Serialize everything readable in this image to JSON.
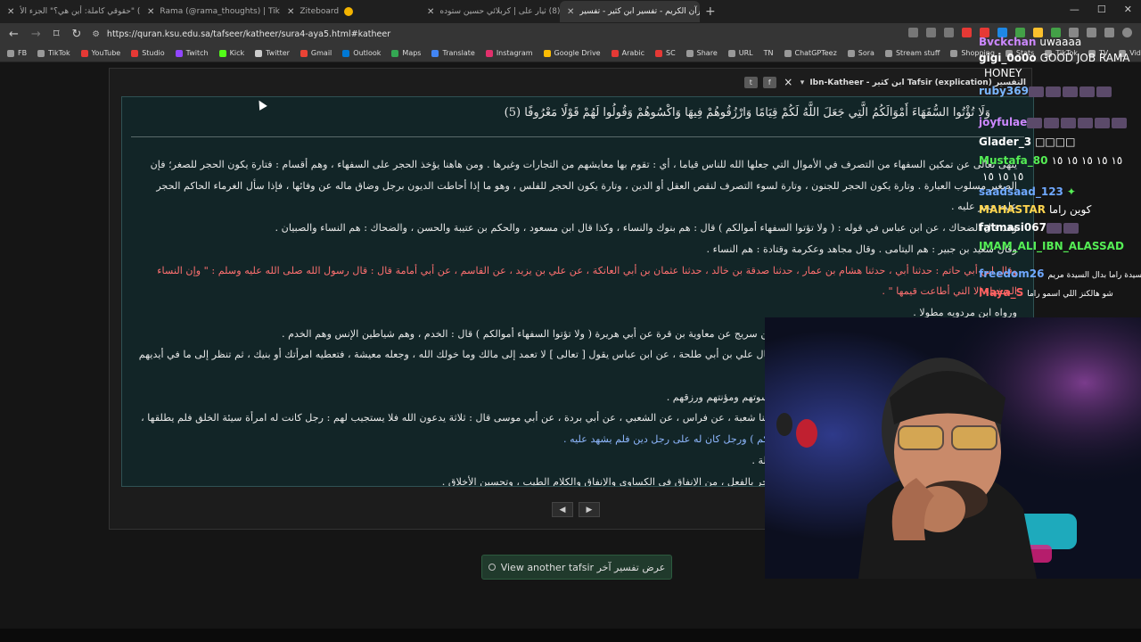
{
  "tabs": [
    {
      "label": "(8) \"حقوقي كاملة: أين هي؟\" الجزء الأ",
      "color": "#e53935"
    },
    {
      "label": "(99+) Rama (@rama_thoughts) | TikTok",
      "color": "#111111"
    },
    {
      "label": "Ziteboard",
      "color": "#f4b400"
    },
    {
      "label": "(8) ثيار على | كربلائي حسين ستوده",
      "color": "#e53935"
    },
    {
      "label": "القرآن الكريم - تفسير ابن كثير - تفسير",
      "color": "#888888",
      "active": true
    }
  ],
  "address": {
    "url": "https://quran.ksu.edu.sa/tafseer/katheer/sura4-aya5.html#katheer"
  },
  "bookmarks": [
    {
      "label": "FB",
      "color": "#999999"
    },
    {
      "label": "TikTok",
      "color": "#999999"
    },
    {
      "label": "YouTube",
      "color": "#e53935"
    },
    {
      "label": "Studio",
      "color": "#e53935"
    },
    {
      "label": "Twitch",
      "color": "#9146ff"
    },
    {
      "label": "Kick",
      "color": "#53fc18"
    },
    {
      "label": "Twitter",
      "color": "#cccccc"
    },
    {
      "label": "Gmail",
      "color": "#ea4335"
    },
    {
      "label": "Outlook",
      "color": "#0078d4"
    },
    {
      "label": "Maps",
      "color": "#34a853"
    },
    {
      "label": "Translate",
      "color": "#4285f4"
    },
    {
      "label": "Instagram",
      "color": "#e1306c"
    },
    {
      "label": "Google Drive",
      "color": "#fbbc04"
    },
    {
      "label": "Arabic",
      "color": "#e53935"
    },
    {
      "label": "SC",
      "color": "#e53935"
    },
    {
      "label": "Share",
      "color": "#999999"
    },
    {
      "label": "URL",
      "color": "#999999"
    },
    {
      "label": "TN",
      "color": "#333333"
    },
    {
      "label": "ChatGPTeez",
      "color": "#999999"
    },
    {
      "label": "Sora",
      "color": "#999999"
    },
    {
      "label": "Stream stuff",
      "color": "#999999"
    },
    {
      "label": "Shopping",
      "color": "#999999"
    },
    {
      "label": "Stats",
      "color": "#999999"
    },
    {
      "label": "TikTok",
      "color": "#999999"
    },
    {
      "label": "TV",
      "color": "#999999"
    },
    {
      "label": "Vids",
      "color": "#999999"
    }
  ],
  "panel": {
    "title": "التفسير Tafsir (explication) ابن كثير - Ibn-Katheer",
    "close": "×",
    "verse": "وَلَا تُؤْتُوا السُّفَهَاءَ أَمْوَالَكُمُ الَّتِي جَعَلَ اللَّهُ لَكُمْ قِيَامًا وَارْزُقُوهُمْ فِيهَا وَاكْسُوهُمْ وَقُولُوا لَهُمْ قَوْلًا مَعْرُوفًا (5)",
    "lines": [
      "ينهى تعالى عن تمكين السفهاء من التصرف في الأموال التي جعلها الله للناس قياما ، أي : تقوم بها معايشهم من التجارات وغيرها . ومن هاهنا يؤخذ الحجر على السفهاء ، وهم أقسام : فتارة يكون الحجر للصغر؛ فإن",
      "الصغير مسلوب العبارة . وتارة يكون الحجر للجنون ، وتارة لسوء التصرف لنقص العقل أو الدين ، وتارة يكون الحجر للفلس ، وهو ما إذا أحاطت الديون برجل وضاق ماله عن وفائها ، فإذا سأل الغرماء الحاكم الحجر",
      "عليه حجر عليه .",
      "وقد قال الضحاك ، عن ابن عباس في قوله : ( ولا تؤتوا السفهاء أموالكم ) قال : هم بنوك والنساء ، وكذا قال ابن مسعود ، والحكم بن عتيبة والحسن ، والضحاك : هم النساء والصبيان .",
      "وقال سعيد بن جبير : هم اليتامى . وقال مجاهد وعكرمة وقتادة : هم النساء .",
      "وقال ابن أبي حاتم : حدثنا أبي ، حدثنا هشام بن عمار ، حدثنا صدقة بن خالد ، حدثنا عثمان بن أبي العاتكة ، عن علي بن يزيد ، عن القاسم ، عن أبي أمامة قال : قال رسول الله صلى الله عليه وسلم : \" وإن النساء",
      "السفهاء إلا التي أطاعت قيمها \" .",
      "ورواه ابن مردويه مطولا .",
      "وقال ابن أبي حاتم : ذكر عن مسلم بن إبراهيم ، حدثنا حرب بن سريج عن معاوية بن قرة عن أبي هريرة ( ولا تؤتوا السفهاء أموالكم ) قال : الخدم ، وهم شياطين الإنس وهم الخدم .",
      "وقوله : ( وارزقوهم فيها واكسوهم وقولوا لهم قولا معروفا ) قال علي بن أبي طلحة ، عن ابن عباس يقول [ تعالى ] لا تعمد إلى مالك وما خولك الله ، وجعله معيشة ، فتعطيه امرأتك أو بنيك ، ثم تنظر إلى ما في أيديهم ،",
      "ولكن أمسك مالك وأصلحه ، وكن أنت الذي تنفق عليهم من كسوتهم ومؤنتهم ورزقهم .",
      "وقال ابن جرير : حدثنا ابن المثنى ، حدثنا محمد بن جعفر ، حدثنا شعبة ، عن فراس ، عن الشعبي ، عن أبي بردة ، عن أبي موسى قال : ثلاثة يدعون الله فلا يستجيب لهم : رجل كانت له امرأة سيئة الخلق فلم يطلقها ،",
      "ورجل أعطى ماله سفيها ، وقد قال : ( ولا تؤتوا السفهاء أموالكم ) ورجل كان له على رجل دين فلم يشهد عليه .",
      "وقال مجاهد : ( وقولوا لهم قولا معروفا ) يعني : في البر والصلة .",
      "وهذه الآية الكريمة تضمنت الإحسان إلى العائلة ومن تحت الحجر بالفعل ، من الإنفاق في الكساوى والإنفاق والكلام الطيب ، وتحسين الأخلاق ."
    ],
    "prev": "◀",
    "next": "▶",
    "another_tafsir": "View another tafsir عرض تفسير آخر"
  },
  "chat": [
    {
      "user": "Bvckchan",
      "msg": "uwaaaa",
      "color": "#cc88ff"
    },
    {
      "user": "gigi_0o0o",
      "msg": "GOOD JOB RAMA",
      "color": "#ffffff"
    },
    {
      "user": "",
      "msg": "HONEY",
      "color": "#ffffff"
    },
    {
      "user": "ruby369",
      "msg": "",
      "color": "#7ab6ff"
    },
    {
      "user": "joyfulae",
      "msg": "",
      "color": "#cc88ff"
    },
    {
      "user": "Glader_3",
      "msg": "□□□□",
      "color": "#ffffff"
    },
    {
      "user": "Mustafa_80",
      "msg": "١٥ ١٥ ١٥ ١٥ ١٥",
      "color": "#55ee55"
    },
    {
      "user": "",
      "msg": "١٥ ١٥ ١٥",
      "color": "#ffffff"
    },
    {
      "user": "saadsaad_123",
      "msg": "",
      "color": "#6fa8ff"
    },
    {
      "user": "MAHASTAR",
      "msg": "كوين راما",
      "color": "#ffd54f"
    },
    {
      "user": "fatmasi067",
      "msg": "",
      "color": "#ffffff"
    },
    {
      "user": "IMAM_ALI_IBN_ALASSAD",
      "msg": "",
      "color": "#55ee55"
    },
    {
      "user": "freedom26",
      "msg": "السيدة راما بدال السيدة مريم",
      "color": "#6fa8ff"
    },
    {
      "user": "Maya_S",
      "msg": "شو هالكنز اللي اسمو راما",
      "color": "#ff6060"
    }
  ]
}
